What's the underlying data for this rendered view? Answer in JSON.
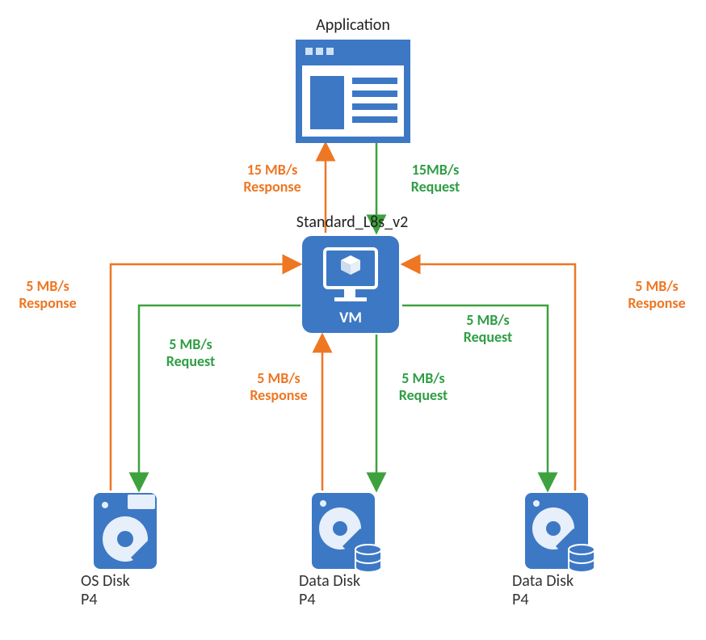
{
  "application": {
    "title": "Application"
  },
  "vm": {
    "title": "Standard_L8s_v2",
    "box_label": "VM"
  },
  "disks": {
    "os": {
      "line1": "OS Disk",
      "line2": "P4"
    },
    "data1": {
      "line1": "Data Disk",
      "line2": "P4"
    },
    "data2": {
      "line1": "Data Disk",
      "line2": "P4"
    }
  },
  "flows": {
    "app_resp": {
      "l1": "15 MB/s",
      "l2": "Response"
    },
    "app_req": {
      "l1": "15MB/s",
      "l2": "Request"
    },
    "os_resp": {
      "l1": "5 MB/s",
      "l2": "Response"
    },
    "os_req": {
      "l1": "5 MB/s",
      "l2": "Request"
    },
    "d1_resp": {
      "l1": "5 MB/s",
      "l2": "Response"
    },
    "d1_req": {
      "l1": "5 MB/s",
      "l2": "Request"
    },
    "d2_resp": {
      "l1": "5 MB/s",
      "l2": "Response"
    },
    "d2_req": {
      "l1": "5 MB/s",
      "l2": "Request"
    }
  },
  "colors": {
    "blue": "#3d78c5",
    "light": "#cfe0f3",
    "white": "#ffffff",
    "green": "#3da23d",
    "orange": "#ee7723"
  }
}
